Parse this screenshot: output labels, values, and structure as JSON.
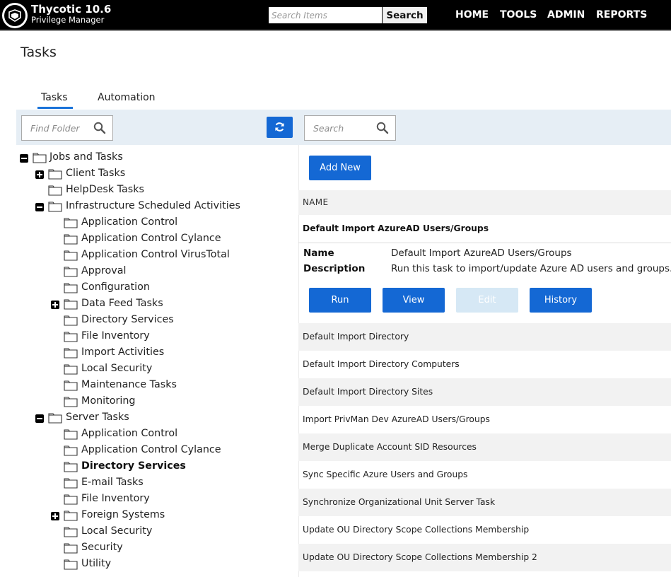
{
  "header": {
    "brand_title": "Thycotic 10.6",
    "brand_subtitle": "Privilege Manager",
    "search_placeholder": "Search Items",
    "search_button": "Search",
    "nav": [
      "HOME",
      "TOOLS",
      "ADMIN",
      "REPORTS"
    ]
  },
  "page": {
    "title": "Tasks",
    "tabs": [
      {
        "label": "Tasks",
        "active": true
      },
      {
        "label": "Automation",
        "active": false
      }
    ]
  },
  "left": {
    "find_placeholder": "Find Folder",
    "tree": [
      {
        "label": "Jobs and Tasks",
        "level": 0,
        "toggle": "minus"
      },
      {
        "label": "Client Tasks",
        "level": 1,
        "toggle": "plus"
      },
      {
        "label": "HelpDesk Tasks",
        "level": 1,
        "toggle": ""
      },
      {
        "label": "Infrastructure Scheduled Activities",
        "level": 1,
        "toggle": "minus"
      },
      {
        "label": "Application Control",
        "level": 2,
        "toggle": ""
      },
      {
        "label": "Application Control Cylance",
        "level": 2,
        "toggle": ""
      },
      {
        "label": "Application Control VirusTotal",
        "level": 2,
        "toggle": ""
      },
      {
        "label": "Approval",
        "level": 2,
        "toggle": ""
      },
      {
        "label": "Configuration",
        "level": 2,
        "toggle": ""
      },
      {
        "label": "Data Feed Tasks",
        "level": 2,
        "toggle": "plus"
      },
      {
        "label": "Directory Services",
        "level": 2,
        "toggle": ""
      },
      {
        "label": "File Inventory",
        "level": 2,
        "toggle": ""
      },
      {
        "label": "Import Activities",
        "level": 2,
        "toggle": ""
      },
      {
        "label": "Local Security",
        "level": 2,
        "toggle": ""
      },
      {
        "label": "Maintenance Tasks",
        "level": 2,
        "toggle": ""
      },
      {
        "label": "Monitoring",
        "level": 2,
        "toggle": ""
      },
      {
        "label": "Server Tasks",
        "level": 1,
        "toggle": "minus"
      },
      {
        "label": "Application Control",
        "level": 2,
        "toggle": ""
      },
      {
        "label": "Application Control Cylance",
        "level": 2,
        "toggle": ""
      },
      {
        "label": "Directory Services",
        "level": 2,
        "toggle": "",
        "selected": true
      },
      {
        "label": "E-mail Tasks",
        "level": 2,
        "toggle": ""
      },
      {
        "label": "File Inventory",
        "level": 2,
        "toggle": ""
      },
      {
        "label": "Foreign Systems",
        "level": 2,
        "toggle": "plus"
      },
      {
        "label": "Local Security",
        "level": 2,
        "toggle": ""
      },
      {
        "label": "Security",
        "level": 2,
        "toggle": ""
      },
      {
        "label": "Utility",
        "level": 2,
        "toggle": ""
      }
    ]
  },
  "right": {
    "search_placeholder": "Search",
    "add_new": "Add New",
    "column_header": "NAME",
    "selected": {
      "title": "Default Import AzureAD Users/Groups",
      "name_label": "Name",
      "name_value": "Default Import AzureAD Users/Groups",
      "description_label": "Description",
      "description_value": "Run this task to import/update Azure AD users and groups.",
      "buttons": [
        {
          "label": "Run",
          "enabled": true
        },
        {
          "label": "View",
          "enabled": true
        },
        {
          "label": "Edit",
          "enabled": false
        },
        {
          "label": "History",
          "enabled": true
        }
      ]
    },
    "tasks": [
      "Default Import Directory",
      "Default Import Directory Computers",
      "Default Import Directory Sites",
      "Import PrivMan Dev AzureAD Users/Groups",
      "Merge Duplicate Account SID Resources",
      "Sync Specific Azure Users and Groups",
      "Synchronize Organizational Unit Server Task",
      "Update OU Directory Scope Collections Membership",
      "Update OU Directory Scope Collections Membership 2"
    ]
  },
  "colors": {
    "primary": "#1468d4",
    "disabled": "#d6e8f5",
    "toolbar": "#e6eef5",
    "header": "#000000"
  }
}
